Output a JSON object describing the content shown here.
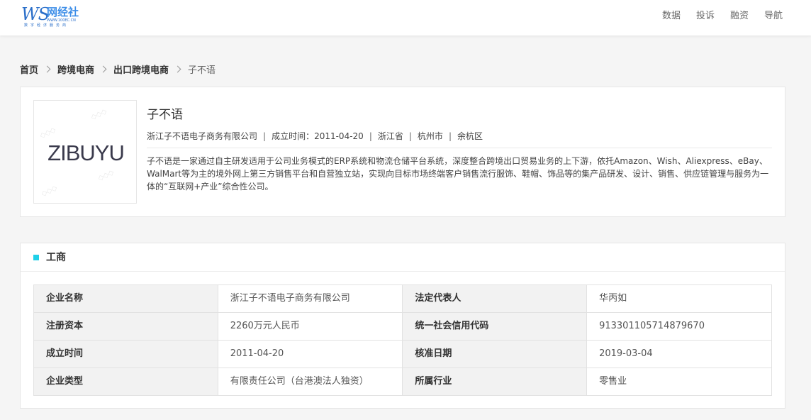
{
  "header": {
    "logo": {
      "ws": "WS",
      "cn": "网经社",
      "url": "WWW.100EC.CN",
      "slogan": "数字经济服务商"
    },
    "nav": [
      "数据",
      "投诉",
      "融资",
      "导航"
    ]
  },
  "breadcrumb": [
    "首页",
    "跨境电商",
    "出口跨境电商",
    "子不语"
  ],
  "company": {
    "logo_text": "ZIBUYU",
    "name": "子不语",
    "meta": [
      "浙江子不语电子商务有限公司",
      "成立时间：2011-04-20",
      "浙江省",
      "杭州市",
      "余杭区"
    ],
    "meta_sep": "|",
    "description": "子不语是一家通过自主研发适用于公司业务模式的ERP系统和物流仓储平台系统，深度整合跨境出口贸易业务的上下游，依托Amazon、Wish、Aliexpress、eBay、WalMart等为主的境外网上第三方销售平台和自营独立站，实现向目标市场终端客户销售流行服饰、鞋帽、饰品等的集产品研发、设计、销售、供应链管理与服务为一体的“互联网+产业”综合性公司。"
  },
  "business": {
    "title": "工商",
    "accent_color": "#1fd0e8",
    "rows": [
      [
        {
          "k": "企业名称",
          "v": "浙江子不语电子商务有限公司"
        },
        {
          "k": "法定代表人",
          "v": "华丙如"
        }
      ],
      [
        {
          "k": "注册资本",
          "v": "2260万元人民币"
        },
        {
          "k": "统一社会信用代码",
          "v": "913301105714879670"
        }
      ],
      [
        {
          "k": "成立时间",
          "v": "2011-04-20"
        },
        {
          "k": "核准日期",
          "v": "2019-03-04"
        }
      ],
      [
        {
          "k": "企业类型",
          "v": "有限责任公司（台港澳法人独资）"
        },
        {
          "k": "所属行业",
          "v": "零售业"
        }
      ]
    ]
  }
}
